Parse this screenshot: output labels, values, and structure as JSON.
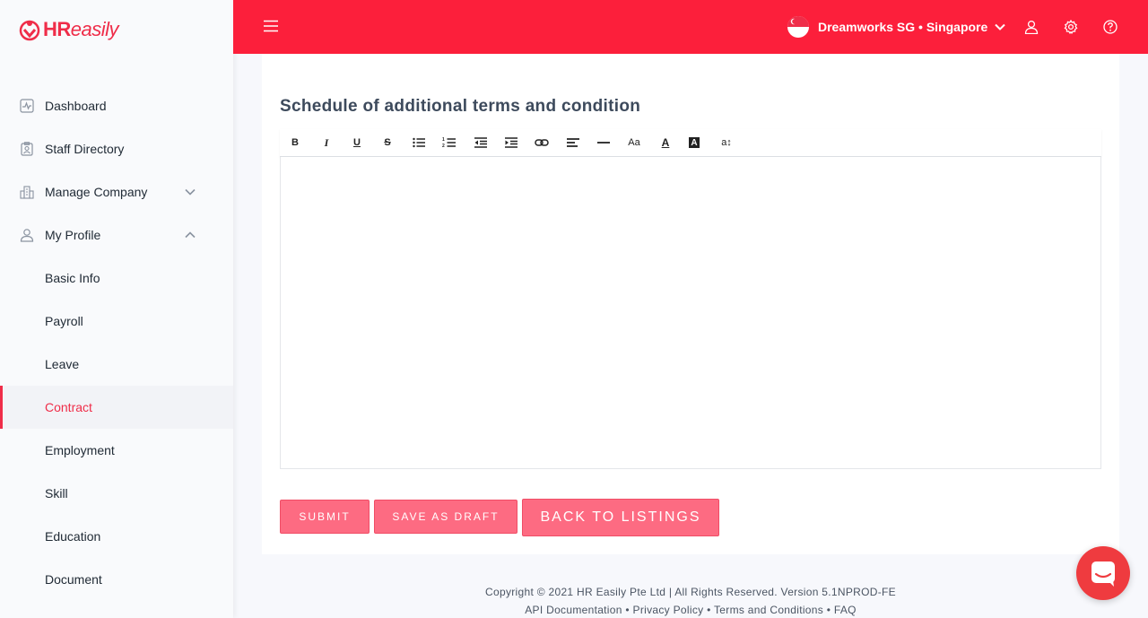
{
  "brand": {
    "logo_hr": "HR",
    "logo_easily": "easily",
    "accent": "#fc1f3b"
  },
  "header": {
    "company_label": "Dreamworks SG • Singapore"
  },
  "sidebar": {
    "items": [
      {
        "label": "Dashboard"
      },
      {
        "label": "Staff Directory"
      },
      {
        "label": "Manage Company"
      },
      {
        "label": "My Profile"
      },
      {
        "label": "Basic Info"
      },
      {
        "label": "Payroll"
      },
      {
        "label": "Leave"
      },
      {
        "label": "Contract",
        "active": true
      },
      {
        "label": "Employment"
      },
      {
        "label": "Skill"
      },
      {
        "label": "Education"
      },
      {
        "label": "Document"
      }
    ]
  },
  "form": {
    "section_title": "Schedule of additional terms and condition",
    "editor_value": "",
    "toolbar": {
      "bold": "B",
      "italic": "I",
      "underline": "U",
      "strike": "S",
      "font_size": "Aa",
      "font_color": "A",
      "highlight": "A",
      "line_height": "a↕"
    }
  },
  "buttons": {
    "submit": "SUBMIT",
    "save_draft": "SAVE AS DRAFT",
    "back": "BACK TO LISTINGS"
  },
  "footer": {
    "copyright": "Copyright © 2021 HR Easily Pte Ltd | All Rights Reserved. Version 5.1NPROD-FE",
    "links": [
      "API Documentation",
      "Privacy Policy",
      "Terms and Conditions",
      "FAQ"
    ],
    "separator": "•"
  }
}
